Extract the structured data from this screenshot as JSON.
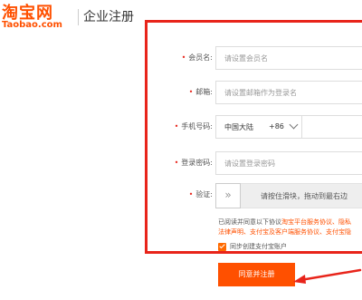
{
  "header": {
    "logo_cn": "淘宝网",
    "logo_en": "Taobao.com",
    "title": "企业注册"
  },
  "form": {
    "member_name": {
      "required_mark": "•",
      "label": "会员名:",
      "placeholder": "请设置会员名"
    },
    "email": {
      "required_mark": "•",
      "label": "邮箱:",
      "placeholder": "请设置邮箱作为登录名"
    },
    "phone": {
      "required_mark": "•",
      "label": "手机号码:",
      "country": "中国大陆",
      "country_code": "+86"
    },
    "password": {
      "required_mark": "•",
      "label": "登录密码:",
      "placeholder": "请设置登录密码"
    },
    "verify": {
      "required_mark": "•",
      "label": "验证:",
      "handle_glyph": "»",
      "slider_text": "请按住滑块，拖动到最右边"
    }
  },
  "agreement": {
    "line1_prefix": "已阅读并同意以下协议",
    "line1_links": "淘宝平台服务协议、隐私",
    "line2": "法律声明、支付宝及客户端服务协议、支付宝隐"
  },
  "checkbox": {
    "label": "同步创建支付宝账户",
    "checked": true
  },
  "submit": {
    "label": "同意并注册"
  },
  "colors": {
    "brand": "#ff5000",
    "highlight": "#e8241a"
  }
}
